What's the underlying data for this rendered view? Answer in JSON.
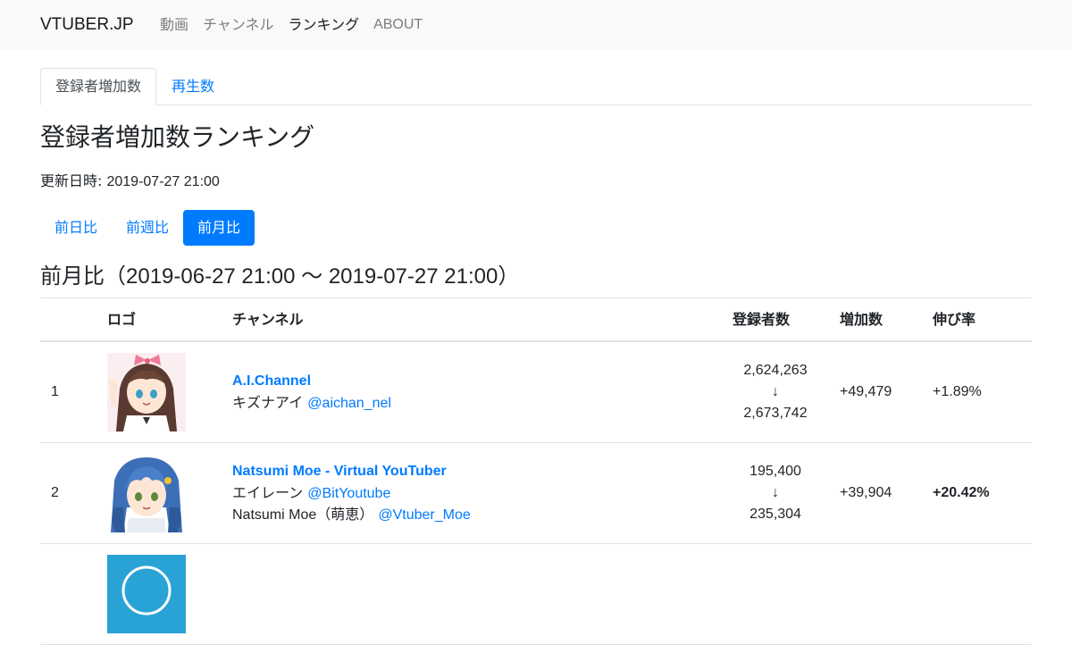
{
  "navbar": {
    "brand": "VTUBER.JP",
    "links": [
      {
        "label": "動画",
        "active": false
      },
      {
        "label": "チャンネル",
        "active": false
      },
      {
        "label": "ランキング",
        "active": true
      },
      {
        "label": "ABOUT",
        "active": false
      }
    ]
  },
  "tabs": [
    {
      "label": "登録者増加数",
      "active": true
    },
    {
      "label": "再生数",
      "active": false
    }
  ],
  "page_title": "登録者増加数ランキング",
  "updated": {
    "label": "更新日時: ",
    "value": "2019-07-27 21:00"
  },
  "period_pills": [
    {
      "label": "前日比",
      "active": false
    },
    {
      "label": "前週比",
      "active": false
    },
    {
      "label": "前月比",
      "active": true
    }
  ],
  "section": {
    "prefix": "前月比（",
    "range": "2019-06-27 21:00 ～ 2019-07-27 21:00",
    "suffix": "）"
  },
  "table": {
    "headers": {
      "logo": "ロゴ",
      "channel": "チャンネル",
      "subscribers": "登録者数",
      "increase": "増加数",
      "growth": "伸び率"
    },
    "rows": [
      {
        "rank": "1",
        "logo_icon": "kizuna-ai-avatar",
        "channel_name": "A.I.Channel",
        "owners": [
          {
            "name": "キズナアイ",
            "handle": "@aichan_nel"
          }
        ],
        "subs_before": "2,624,263",
        "arrow": "↓",
        "subs_after": "2,673,742",
        "increase": "+49,479",
        "growth": "+1.89%",
        "growth_bold": false
      },
      {
        "rank": "2",
        "logo_icon": "natsumi-moe-avatar",
        "channel_name": "Natsumi Moe - Virtual YouTuber",
        "owners": [
          {
            "name": "エイレーン",
            "handle": "@BitYoutube"
          },
          {
            "name": "Natsumi Moe（萌恵）",
            "handle": "@Vtuber_Moe"
          }
        ],
        "subs_before": "195,400",
        "arrow": "↓",
        "subs_after": "235,304",
        "increase": "+39,904",
        "growth": "+20.42%",
        "growth_bold": true
      },
      {
        "rank": "",
        "logo_icon": "channel-avatar-partial",
        "channel_name": "",
        "owners": [],
        "subs_before": "",
        "arrow": "",
        "subs_after": "",
        "increase": "",
        "growth": "",
        "growth_bold": false
      }
    ]
  },
  "colors": {
    "link": "#007bff",
    "navbar_bg": "#f8f9fa",
    "border": "#dee2e6",
    "pill_active_bg": "#007bff"
  }
}
